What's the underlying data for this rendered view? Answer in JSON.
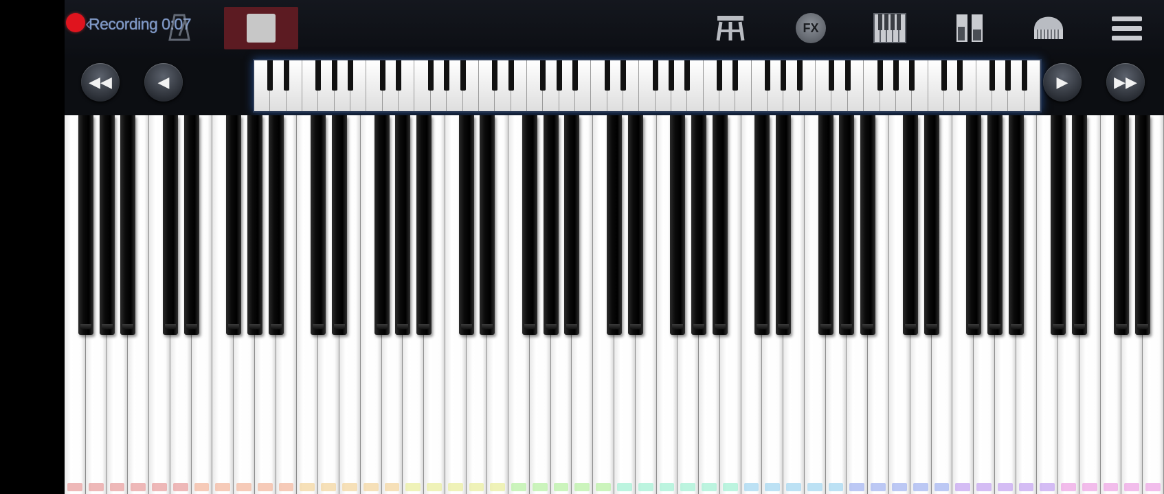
{
  "recording": {
    "text": "Recording 0:07",
    "dot_color": "#e0141e"
  },
  "toolbar": {
    "icons": [
      "piano-stool-icon",
      "fx-icon",
      "piano-keys-icon",
      "dual-keyboard-icon",
      "grand-piano-icon",
      "menu-icon"
    ],
    "fx_label": "FX"
  },
  "nav": {
    "icons": [
      "fast-rewind-icon",
      "rewind-icon",
      "play-icon",
      "fast-forward-icon"
    ]
  },
  "keyboard": {
    "white_key_count": 52,
    "note_colors": [
      "#e8a0a0",
      "#f3b8a0",
      "#f3d6a0",
      "#e9eea0",
      "#b9f0a6",
      "#a6f0d4",
      "#a6d7f0",
      "#a6b5f0",
      "#c6a6f0",
      "#eda6e4"
    ]
  }
}
